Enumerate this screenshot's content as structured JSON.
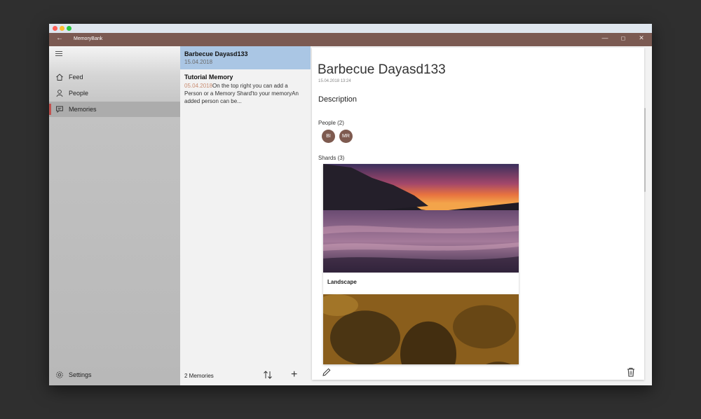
{
  "window": {
    "title": "MemoryBank",
    "controls": {
      "minimize": "—",
      "maximize": "◻",
      "close": "✕"
    },
    "back_icon": "←"
  },
  "sidebar": {
    "items": [
      {
        "label": "Feed",
        "icon": "home-icon"
      },
      {
        "label": "People",
        "icon": "person-icon"
      },
      {
        "label": "Memories",
        "icon": "chat-icon",
        "active": true
      }
    ],
    "settings_label": "Settings"
  },
  "memory_list": {
    "items": [
      {
        "title": "Barbecue Dayasd133",
        "date": "15.04.2018",
        "selected": true
      },
      {
        "title": "Tutorial Memory",
        "date": "05.04.2018",
        "snippet": "On the top right you can add a Person or a Memory Shard'to your memoryAn added person can be..."
      }
    ],
    "count_label": "2 Memories",
    "add_icon": "+"
  },
  "detail": {
    "title": "Barbecue Dayasd133",
    "datetime": "15.04.2018 13:24",
    "description_heading": "Description",
    "people_label": "People (2)",
    "people": [
      "BI",
      "MR"
    ],
    "shards_label": "Shards (3)",
    "shards": [
      {
        "caption": "Landscape"
      },
      {
        "caption": ""
      }
    ]
  },
  "colors": {
    "titlebar": "#7b5a52",
    "selected_item": "#aac6e4",
    "accent_marker": "#c0504d",
    "avatar": "#7e5a4f"
  }
}
